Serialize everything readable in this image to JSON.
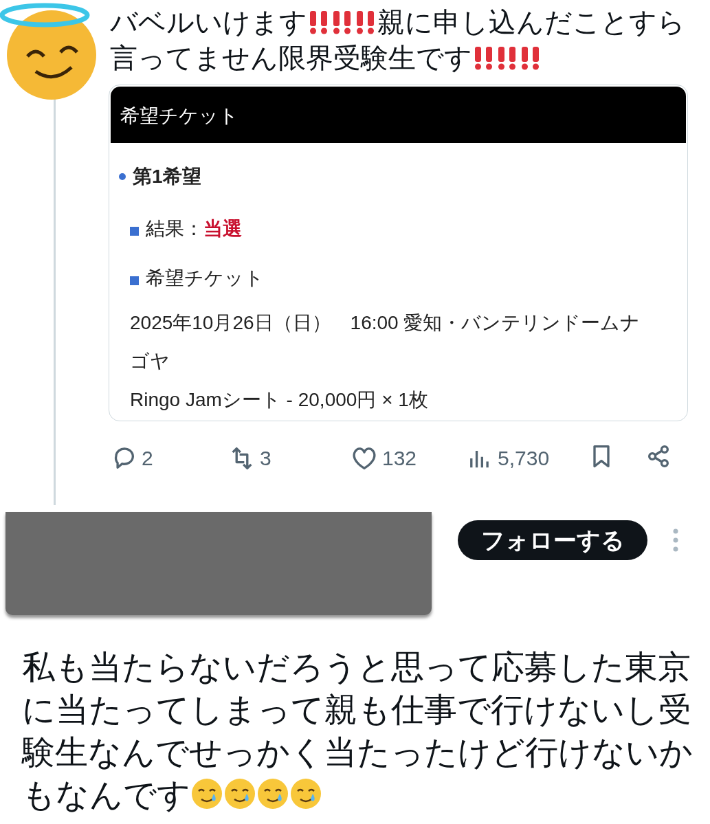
{
  "post": {
    "avatar": {
      "kind": "emoji-avatar"
    },
    "text": [
      {
        "kind": "text",
        "text": "バベルいけます"
      },
      {
        "kind": "bang"
      },
      {
        "kind": "bang"
      },
      {
        "kind": "bang"
      },
      {
        "kind": "text",
        "text": "親に申し込んだことすら言ってません限界受験生です"
      },
      {
        "kind": "bang"
      },
      {
        "kind": "bang"
      },
      {
        "kind": "bang"
      }
    ],
    "ticket": {
      "header": "希望チケット",
      "choice": "第1希望",
      "result_label": "結果：",
      "result_value": "当選",
      "ticket_label": "希望チケット",
      "lines": [
        "2025年10月26日（日）　16:00  愛知・バンテリンドームナゴヤ",
        "Ringo Jamシート - 20,000円 × 1枚"
      ]
    },
    "actions": [
      {
        "kind": "reply",
        "count": "2"
      },
      {
        "kind": "repost",
        "count": "3"
      },
      {
        "kind": "like",
        "count": "132"
      },
      {
        "kind": "views",
        "count": "5,730"
      },
      {
        "kind": "bookmark"
      },
      {
        "kind": "share"
      }
    ]
  },
  "reply": {
    "follow_button": "フォローする",
    "text": [
      {
        "kind": "text",
        "text": "私も当たらないだろうと思って応募した東京に当たってしまって親も仕事で行けないし受験生なんでせっかく当たったけど行けないかもなんです"
      },
      {
        "kind": "tear"
      },
      {
        "kind": "tear"
      },
      {
        "kind": "tear"
      },
      {
        "kind": "tear"
      }
    ]
  }
}
